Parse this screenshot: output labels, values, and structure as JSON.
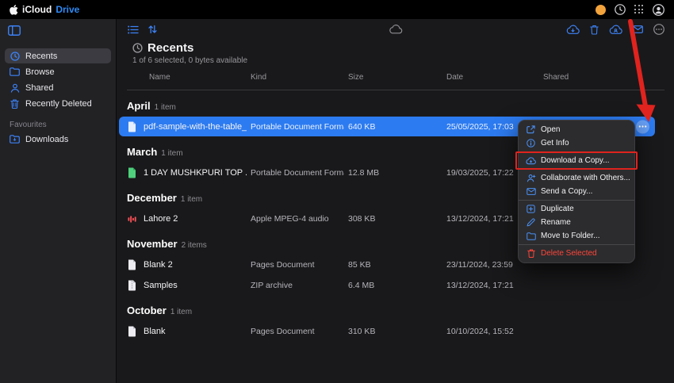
{
  "topbar": {
    "brand_icloud": "iCloud",
    "brand_drive": "Drive"
  },
  "sidebar": {
    "items": [
      {
        "label": "Recents",
        "icon": "clock-icon",
        "selected": true
      },
      {
        "label": "Browse",
        "icon": "folder-icon"
      },
      {
        "label": "Shared",
        "icon": "person-icon"
      },
      {
        "label": "Recently Deleted",
        "icon": "trash-icon"
      }
    ],
    "favourites_label": "Favourites",
    "favourites": [
      {
        "label": "Downloads",
        "icon": "downloads-folder-icon"
      }
    ]
  },
  "main": {
    "title": "Recents",
    "subtitle": "1 of 6 selected, 0 bytes available",
    "columns": {
      "name": "Name",
      "kind": "Kind",
      "size": "Size",
      "date": "Date",
      "shared": "Shared"
    },
    "sections": [
      {
        "month": "April",
        "count": "1 item",
        "rows": [
          {
            "name": "pdf-sample-with-the-table_p...",
            "kind": "Portable Document Forma...",
            "size": "640 KB",
            "date": "25/05/2025, 17:03",
            "icon": "pdf-document-icon",
            "selected": true
          }
        ]
      },
      {
        "month": "March",
        "count": "1 item",
        "rows": [
          {
            "name": "1 DAY MUSHKPURI TOP ...",
            "kind": "Portable Document Forma...",
            "size": "12.8 MB",
            "date": "19/03/2025, 17:22",
            "icon": "document-green-icon"
          }
        ]
      },
      {
        "month": "December",
        "count": "1 item",
        "rows": [
          {
            "name": "Lahore 2",
            "kind": "Apple MPEG-4 audio",
            "size": "308 KB",
            "date": "13/12/2024, 17:21",
            "icon": "audio-waveform-icon"
          }
        ]
      },
      {
        "month": "November",
        "count": "2 items",
        "rows": [
          {
            "name": "Blank 2",
            "kind": "Pages Document",
            "size": "85 KB",
            "date": "23/11/2024, 23:59",
            "icon": "pages-document-icon"
          },
          {
            "name": "Samples",
            "kind": "ZIP archive",
            "size": "6.4 MB",
            "date": "13/12/2024, 17:21",
            "icon": "zip-archive-icon"
          }
        ]
      },
      {
        "month": "October",
        "count": "1 item",
        "rows": [
          {
            "name": "Blank",
            "kind": "Pages Document",
            "size": "310 KB",
            "date": "10/10/2024, 15:52",
            "icon": "pages-document-icon"
          }
        ]
      }
    ]
  },
  "context_menu": {
    "groups": [
      [
        {
          "label": "Open",
          "icon": "open-icon"
        },
        {
          "label": "Get Info",
          "icon": "info-icon"
        }
      ],
      [
        {
          "label": "Download a Copy...",
          "icon": "download-cloud-icon",
          "highlighted": true
        }
      ],
      [
        {
          "label": "Collaborate with Others...",
          "icon": "collaborate-icon"
        },
        {
          "label": "Send a Copy...",
          "icon": "send-copy-icon"
        }
      ],
      [
        {
          "label": "Duplicate",
          "icon": "duplicate-icon"
        },
        {
          "label": "Rename",
          "icon": "rename-icon"
        },
        {
          "label": "Move to Folder...",
          "icon": "move-folder-icon"
        }
      ],
      [
        {
          "label": "Delete Selected",
          "icon": "delete-icon",
          "danger": true
        }
      ]
    ]
  },
  "colors": {
    "accent_blue": "#3c82f7",
    "selection_blue": "#2d7bf0",
    "annotation_red": "#e0231e",
    "danger_red": "#ff453a",
    "avatar_orange": "#f2a33c"
  }
}
